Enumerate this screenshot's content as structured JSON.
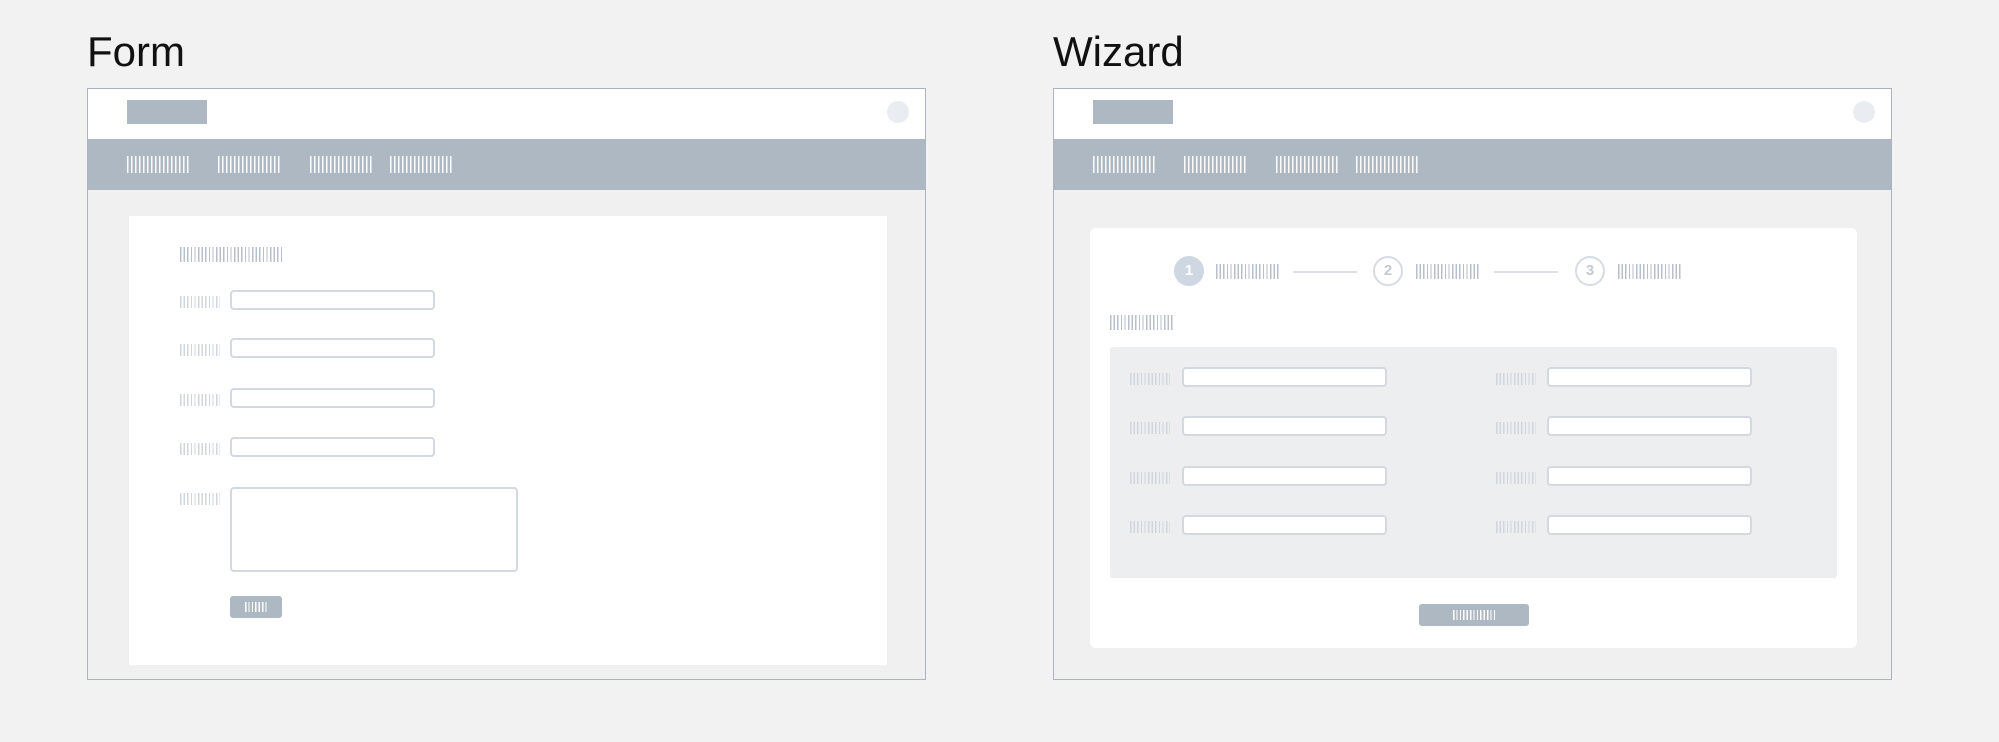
{
  "panels": {
    "form": {
      "title": "Form"
    },
    "wizard": {
      "title": "Wizard",
      "steps": [
        "1",
        "2",
        "3"
      ]
    }
  },
  "colors": {
    "background": "#f2f2f2",
    "frame_border": "#aab3bf",
    "navbar": "#aeb8c3",
    "placeholder_text": "#b7bfc9",
    "input_border": "#d3d8e1",
    "wizard_active_step": "#cfd7e2",
    "field_group_bg": "#eceef0"
  }
}
